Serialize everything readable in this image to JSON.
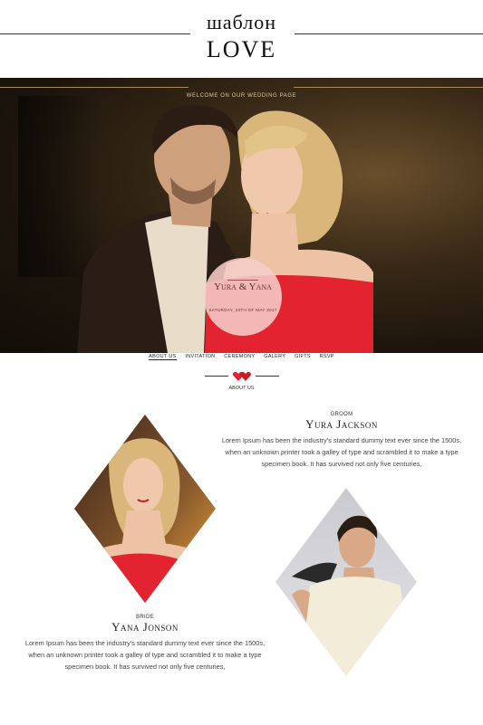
{
  "header": {
    "logo_top": "шаблон",
    "logo_bottom": "LOVE"
  },
  "hero": {
    "welcome": "WELCOME ON OUR WEDDING PAGE",
    "couple_names": "Yura & Yana",
    "date": "SATURDAY, 23TH OF MAY 2017"
  },
  "nav": {
    "items": [
      "ABOUT US",
      "INVITATION",
      "CEREMONY",
      "GALERY",
      "GIFTS",
      "RSVP"
    ]
  },
  "about": {
    "title": "ABOUT US"
  },
  "groom": {
    "role": "GROOM",
    "name": "Yura Jackson",
    "bio": "Lorem Ipsum has been the industry's standard dummy text ever since the 1500s, when an unknown printer took a galley of type and scrambled it to make a type specimen  book.  It has survived not only five centuries,"
  },
  "bride": {
    "role": "BRIDE",
    "name": "Yana Jonson",
    "bio": "Lorem Ipsum has been the industry's standard dummy text ever since the 1500s, when an unknown printer took a galley of type and scrambled it to make a type specimen  book.  It has survived not only five centuries,"
  },
  "colors": {
    "accent_red": "#e3232f",
    "badge_pink": "#f5cdc8",
    "hero_dark": "#1c140c"
  }
}
